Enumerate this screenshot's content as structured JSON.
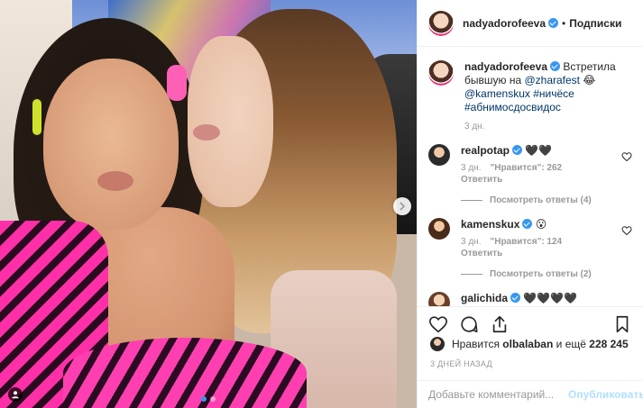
{
  "header": {
    "username": "nadyadorofeeva",
    "separator": "•",
    "follow_label": "Подписки"
  },
  "caption": {
    "username": "nadyadorofeeva",
    "text_before_mention": "Встретила бывшую на ",
    "mention_1": "@zharafest",
    "emoji": "😂",
    "mention_2": "@kamenskux",
    "hashtag_1": "#ничёсе",
    "hashtag_2": "#абнимосдосвидос",
    "time": "3 дн."
  },
  "comments": [
    {
      "username": "realpotap",
      "text": "🖤🖤",
      "time": "3 дн.",
      "likes": "\"Нравится\": 262",
      "reply_label": "Ответить",
      "view_replies": "Посмотреть ответы (4)"
    },
    {
      "username": "kamenskux",
      "text": "😮",
      "time": "3 дн.",
      "likes": "\"Нравится\": 124",
      "reply_label": "Ответить",
      "view_replies": "Посмотреть ответы (2)"
    },
    {
      "username": "galichida",
      "text": "🖤🖤🖤🖤"
    }
  ],
  "likes": {
    "prefix": "Нравится ",
    "user": "olbalaban",
    "middle": " и ещё ",
    "count": "228 245"
  },
  "post_time": "3 ДНЕЙ НАЗАД",
  "add_comment": {
    "placeholder": "Добавьте комментарий...",
    "publish_label": "Опубликовать"
  },
  "colors": {
    "verified": "#3897f0",
    "link": "#003569",
    "publish_disabled": "#b2dffc",
    "meta_gray": "#999999"
  },
  "icons": [
    "heart-icon",
    "comment-icon",
    "share-icon",
    "bookmark-icon",
    "chevron-right-icon",
    "user-tag-icon",
    "verified-badge-icon"
  ],
  "carousel": {
    "slides": 2,
    "active": 1
  }
}
